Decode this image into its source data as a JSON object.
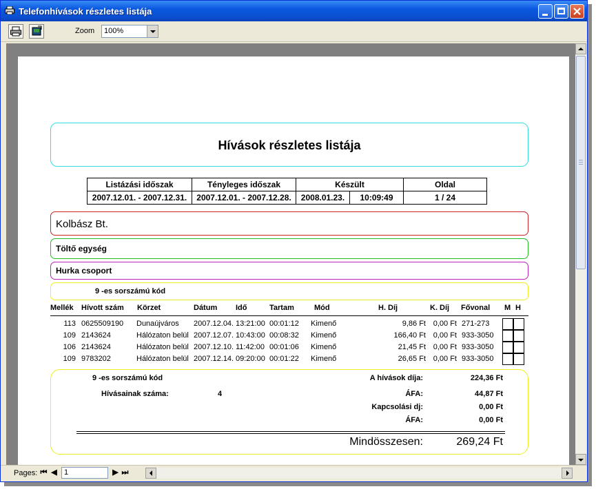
{
  "window": {
    "title": "Telefonhívások részletes listája"
  },
  "toolbar": {
    "zoom_label": "Zoom",
    "zoom_value": "100%"
  },
  "report": {
    "title": "Hívások részletes listája",
    "header_cols": [
      "Listázási időszak",
      "Tényleges időszak",
      "Készült",
      "Oldal"
    ],
    "listing_period": "2007.12.01. - 2007.12.31.",
    "actual_period": "2007.12.01. - 2007.12.28.",
    "made_date": "2008.01.23.",
    "made_time": "10:09:49",
    "page": "1 / 24",
    "company": "Kolbász Bt.",
    "unit": "Töltő egység",
    "group": "Hurka csoport",
    "code_label": "9  -es sorszámú kód",
    "columns": [
      "Mellék",
      "Hívott szám",
      "Körzet",
      "Dátum",
      "Idő",
      "Tartam",
      "Mód",
      "H. Díj",
      "K. Díj",
      "Fővonal",
      "M",
      "H"
    ],
    "rows": [
      {
        "mellek": "113",
        "szam": "0625509190",
        "korzet": "Dunaújváros",
        "datum": "2007.12.04.",
        "ido": "13:21:00",
        "tartam": "00:01:12",
        "mod": "Kimenő",
        "hdij": "9,86 Ft",
        "kdij": "0,00 Ft",
        "fovonal": "271-273"
      },
      {
        "mellek": "109",
        "szam": "2143624",
        "korzet": "Hálózaton belül",
        "datum": "2007.12.07.",
        "ido": "10:43:00",
        "tartam": "00:08:32",
        "mod": "Kimenő",
        "hdij": "166,40 Ft",
        "kdij": "0,00 Ft",
        "fovonal": "933-3050"
      },
      {
        "mellek": "106",
        "szam": "2143624",
        "korzet": "Hálózaton belül",
        "datum": "2007.12.10.",
        "ido": "11:42:00",
        "tartam": "00:01:06",
        "mod": "Kimenő",
        "hdij": "21,45 Ft",
        "kdij": "0,00 Ft",
        "fovonal": "933-3050"
      },
      {
        "mellek": "109",
        "szam": "9783202",
        "korzet": "Hálózaton belül",
        "datum": "2007.12.14.",
        "ido": "09:20:00",
        "tartam": "00:01:22",
        "mod": "Kimenő",
        "hdij": "26,65 Ft",
        "kdij": "0,00 Ft",
        "fovonal": "933-3050"
      }
    ],
    "summary": {
      "code_label": "9  -es sorszámú kód",
      "calls_label": "Hívásainak száma:",
      "calls_value": "4",
      "fee_label": "A hívások díja:",
      "fee_value": "224,36 Ft",
      "vat_label": "ÁFA:",
      "vat_value": "44,87 Ft",
      "conn_label": "Kapcsolási dj:",
      "conn_value": "0,00 Ft",
      "vat2_label": "ÁFA:",
      "vat2_value": "0,00 Ft",
      "total_label": "Mindösszesen:",
      "total_value": "269,24 Ft"
    }
  },
  "status": {
    "pages_label": "Pages:",
    "page_value": "1"
  },
  "colors": {
    "title_box": "#33dddd",
    "company_box": "#cc2222",
    "unit_box": "#22bb22",
    "group_box": "#bb22bb",
    "code_box": "#eeee22"
  }
}
